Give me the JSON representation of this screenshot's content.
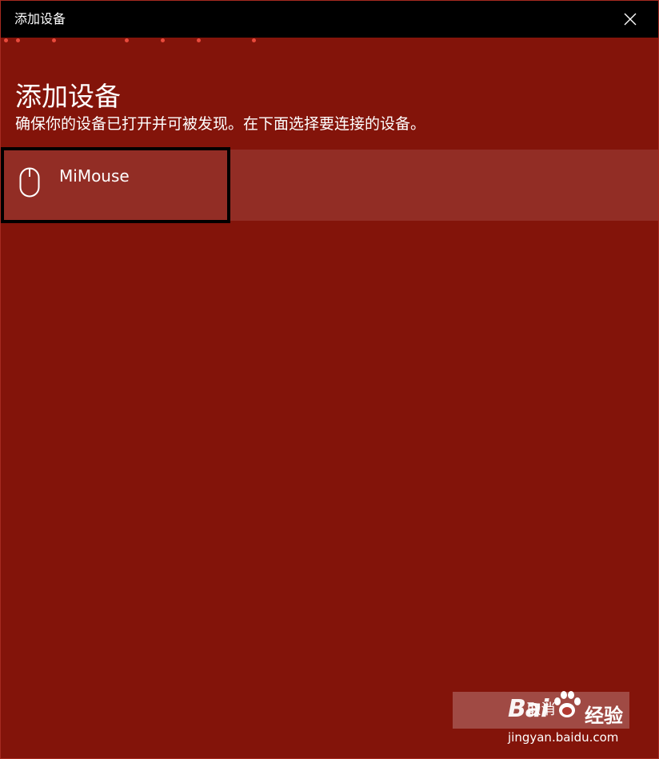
{
  "window": {
    "title": "添加设备",
    "close_icon": "close-icon"
  },
  "page": {
    "heading": "添加设备",
    "subtitle": "确保你的设备已打开并可被发现。在下面选择要连接的设备。"
  },
  "devices": [
    {
      "name": "MiMouse",
      "icon": "mouse-icon"
    }
  ],
  "footer": {
    "cancel_label": "取消"
  },
  "watermark": {
    "logo": "Bai",
    "brand": "经验",
    "url": "jingyan.baidu.com"
  },
  "colors": {
    "background": "#83140a",
    "titlebar": "#000000",
    "device_item": "#922d25",
    "progress_dots": "#e84a3c",
    "cancel_button": "#a04a44"
  }
}
